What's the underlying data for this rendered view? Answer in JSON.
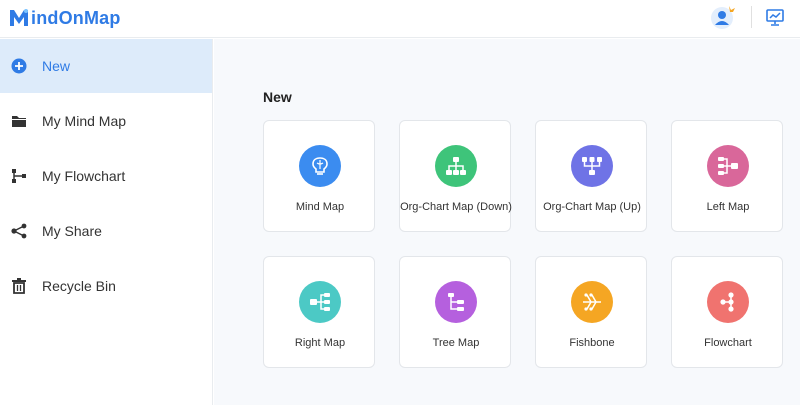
{
  "app": {
    "logo_letter": "M",
    "logo_text": "indOnMap",
    "brand_color": "#2f7be5"
  },
  "header": {
    "user_icon": "user-avatar-icon",
    "present_icon": "presentation-icon"
  },
  "sidebar": {
    "items": [
      {
        "label": "New",
        "icon": "plus-circle-icon",
        "active": true
      },
      {
        "label": "My Mind Map",
        "icon": "folder-icon",
        "active": false
      },
      {
        "label": "My Flowchart",
        "icon": "flowchart-icon",
        "active": false
      },
      {
        "label": "My Share",
        "icon": "share-icon",
        "active": false
      },
      {
        "label": "Recycle Bin",
        "icon": "trash-icon",
        "active": false
      }
    ]
  },
  "main": {
    "section_title": "New",
    "templates": [
      {
        "label": "Mind Map",
        "color": "#3b8cf0",
        "icon": "brain-icon"
      },
      {
        "label": "Org-Chart Map (Down)",
        "color": "#3ec47a",
        "icon": "org-chart-down-icon"
      },
      {
        "label": "Org-Chart Map (Up)",
        "color": "#6f73e6",
        "icon": "org-chart-up-icon"
      },
      {
        "label": "Left Map",
        "color": "#d9679a",
        "icon": "left-map-icon"
      },
      {
        "label": "Right Map",
        "color": "#4cc9c5",
        "icon": "right-map-icon"
      },
      {
        "label": "Tree Map",
        "color": "#b560de",
        "icon": "tree-map-icon"
      },
      {
        "label": "Fishbone",
        "color": "#f5a623",
        "icon": "fishbone-icon"
      },
      {
        "label": "Flowchart",
        "color": "#f0736f",
        "icon": "flowchart-node-icon"
      }
    ]
  }
}
